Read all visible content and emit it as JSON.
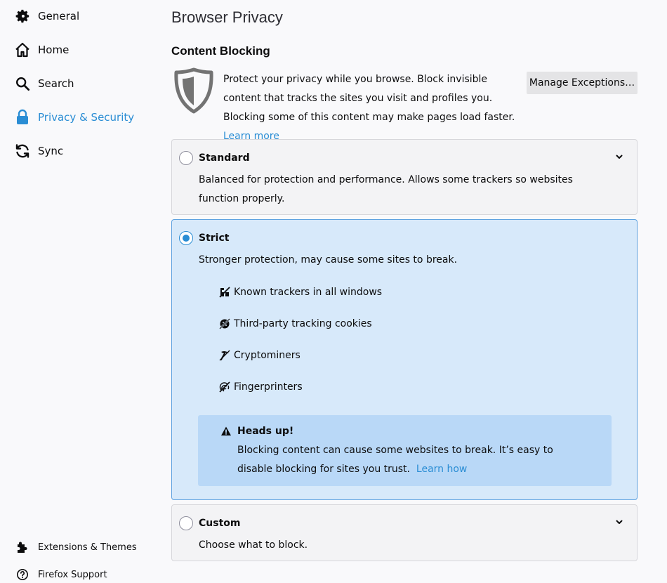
{
  "sidebar": {
    "items": [
      {
        "label": "General",
        "icon": "gear-icon"
      },
      {
        "label": "Home",
        "icon": "home-icon"
      },
      {
        "label": "Search",
        "icon": "search-icon"
      },
      {
        "label": "Privacy & Security",
        "icon": "lock-icon",
        "active": true
      },
      {
        "label": "Sync",
        "icon": "sync-icon"
      }
    ],
    "footer": [
      {
        "label": "Extensions & Themes",
        "icon": "puzzle-icon"
      },
      {
        "label": "Firefox Support",
        "icon": "help-icon"
      }
    ]
  },
  "main": {
    "title": "Browser Privacy",
    "section_title": "Content Blocking",
    "intro_text": "Protect your privacy while you browse. Block invisible content that tracks the sites you visit and profiles you. Blocking some of this content may make pages load faster.",
    "learn_more": "Learn more",
    "manage_button": "Manage Exceptions…",
    "options": {
      "standard": {
        "title": "Standard",
        "description": "Balanced for protection and performance. Allows some trackers so websites function properly.",
        "checked": false
      },
      "strict": {
        "title": "Strict",
        "description": "Stronger protection, may cause some sites to break.",
        "checked": true,
        "features": [
          {
            "label": "Known trackers in all windows",
            "icon": "tracker-icon"
          },
          {
            "label": "Third-party tracking cookies",
            "icon": "cookie-icon"
          },
          {
            "label": "Cryptominers",
            "icon": "cryptominer-icon"
          },
          {
            "label": "Fingerprinters",
            "icon": "fingerprint-icon"
          }
        ],
        "warning": {
          "title": "Heads up!",
          "text": "Blocking content can cause some websites to break. It’s easy to disable blocking for sites you trust.",
          "link": "Learn how"
        }
      },
      "custom": {
        "title": "Custom",
        "description": "Choose what to block.",
        "checked": false
      }
    }
  },
  "colors": {
    "accent": "#2a8dd4",
    "selected_bg": "#d7e9fa",
    "warning_bg": "#b9d8f7"
  }
}
